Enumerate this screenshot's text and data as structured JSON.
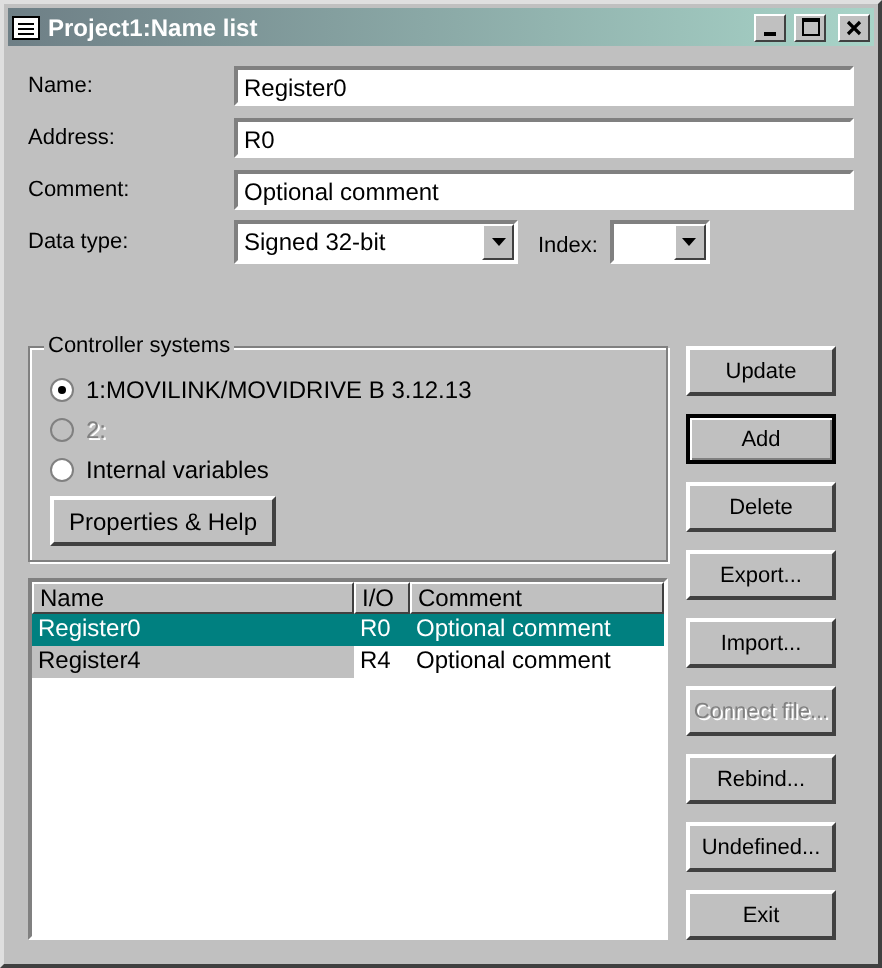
{
  "window": {
    "title": "Project1:Name list"
  },
  "fields": [
    {
      "label": "Name:",
      "value": "Register0"
    },
    {
      "label": "Address:",
      "value": "R0"
    },
    {
      "label": "Comment:",
      "value": "Optional comment"
    }
  ],
  "data_type": {
    "label": "Data type:",
    "value": "Signed 32-bit"
  },
  "index": {
    "label": "Index:"
  },
  "controller_systems": {
    "title": "Controller systems",
    "options": [
      {
        "label": "1:MOVILINK/MOVIDRIVE B 3.12.13",
        "selected": true,
        "disabled": false
      },
      {
        "label": "2:",
        "selected": false,
        "disabled": true
      },
      {
        "label": "Internal variables",
        "selected": false,
        "disabled": false
      }
    ],
    "button": "Properties & Help"
  },
  "table": {
    "columns": [
      "Name",
      "I/O",
      "Comment"
    ],
    "rows": [
      {
        "cells": [
          "Register0",
          "R0",
          "Optional comment"
        ],
        "selected": true,
        "marked": false
      },
      {
        "cells": [
          "Register4",
          "R4",
          "Optional comment"
        ],
        "selected": false,
        "marked": true
      }
    ]
  },
  "buttons": [
    {
      "label": "Update",
      "default": false,
      "disabled": false
    },
    {
      "label": "Add",
      "default": true,
      "disabled": false
    },
    {
      "label": "Delete",
      "default": false,
      "disabled": false
    },
    {
      "label": "Export...",
      "default": false,
      "disabled": false
    },
    {
      "label": "Import...",
      "default": false,
      "disabled": false
    },
    {
      "label": "Connect file...",
      "default": false,
      "disabled": true
    },
    {
      "label": "Rebind...",
      "default": false,
      "disabled": false
    },
    {
      "label": "Undefined...",
      "default": false,
      "disabled": false
    },
    {
      "label": "Exit",
      "default": false,
      "disabled": false
    }
  ]
}
